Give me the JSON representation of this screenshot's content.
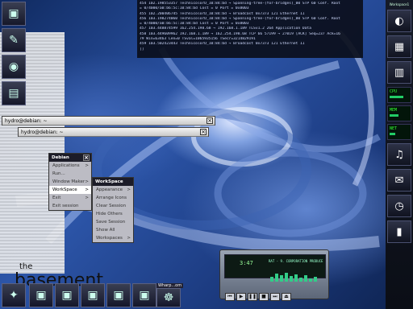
{
  "terminal": {
    "lines": [
      "454 102.198553357 TechnicolorD_10:84:bd → Spanning-tree-(for-bridges)_00 STP 60 Conf. Root",
      "= 0/4000/a0:b6:5c:10:84:bd  Cost = 0  Port = 0x8003",
      "455 102.200406745 TechnicolorD_10:84:bd → Broadcast     0x7373 121 Ethernet II",
      "456 103.198274060 TechnicolorD_10:84:bd → Spanning-tree-(for-bridges)_00 STP 60 Conf. Root",
      "= 0/4000/a0:b6:5c:10:84:bd  Cost = 0  Port = 0x8003",
      "457 103.448874599 162.254.198.68 → 192.168.1.189 TLSv1.2 264 Application Data",
      "458 103.449609962 192.168.1.189 → 162.254.198.68 TCP 66 57199 → 27019 [ACK] Seq=237 Ack=16",
      "79 Win=63463 Len=0 TSval=1065935156 TSecr=3214829191",
      "459 103.502423443 TechnicolorD_10:84:bd → Broadcast     0x7373 121 Ethernet II",
      "[]"
    ]
  },
  "windows": {
    "xterm1_title": "hydro@debian: ~",
    "xterm2_title": "hydro@debian: ~"
  },
  "debian_menu": {
    "title": "Debian",
    "items": [
      {
        "label": "Applications",
        "arrow": ">"
      },
      {
        "label": "Run...",
        "arrow": ""
      },
      {
        "label": "Window Maker",
        "arrow": ">"
      },
      {
        "label": "WorkSpace",
        "arrow": ">"
      },
      {
        "label": "Exit",
        "arrow": ">"
      },
      {
        "label": "Exit session",
        "arrow": ""
      }
    ]
  },
  "workspace_menu": {
    "title": "WorkSpace",
    "items": [
      {
        "label": "Appearance",
        "arrow": ">"
      },
      {
        "label": "Arrange Icons",
        "arrow": ""
      },
      {
        "label": "Clear Session",
        "arrow": ""
      },
      {
        "label": "Hide Others",
        "arrow": ""
      },
      {
        "label": "Save Session",
        "arrow": ""
      },
      {
        "label": "Show All",
        "arrow": ""
      },
      {
        "label": "Workspaces",
        "arrow": ">"
      }
    ]
  },
  "player": {
    "time": "3:47",
    "track": "RAT - 9. CORPORATION PRODUCE"
  },
  "wallpaper": {
    "the": "the",
    "basement": "basement"
  },
  "right_dock": {
    "label": "Workspace1",
    "meter1": "CPU",
    "meter2": "MEM",
    "meter3": "NET"
  },
  "bottom_bar": {
    "label": "Wharp...om"
  }
}
